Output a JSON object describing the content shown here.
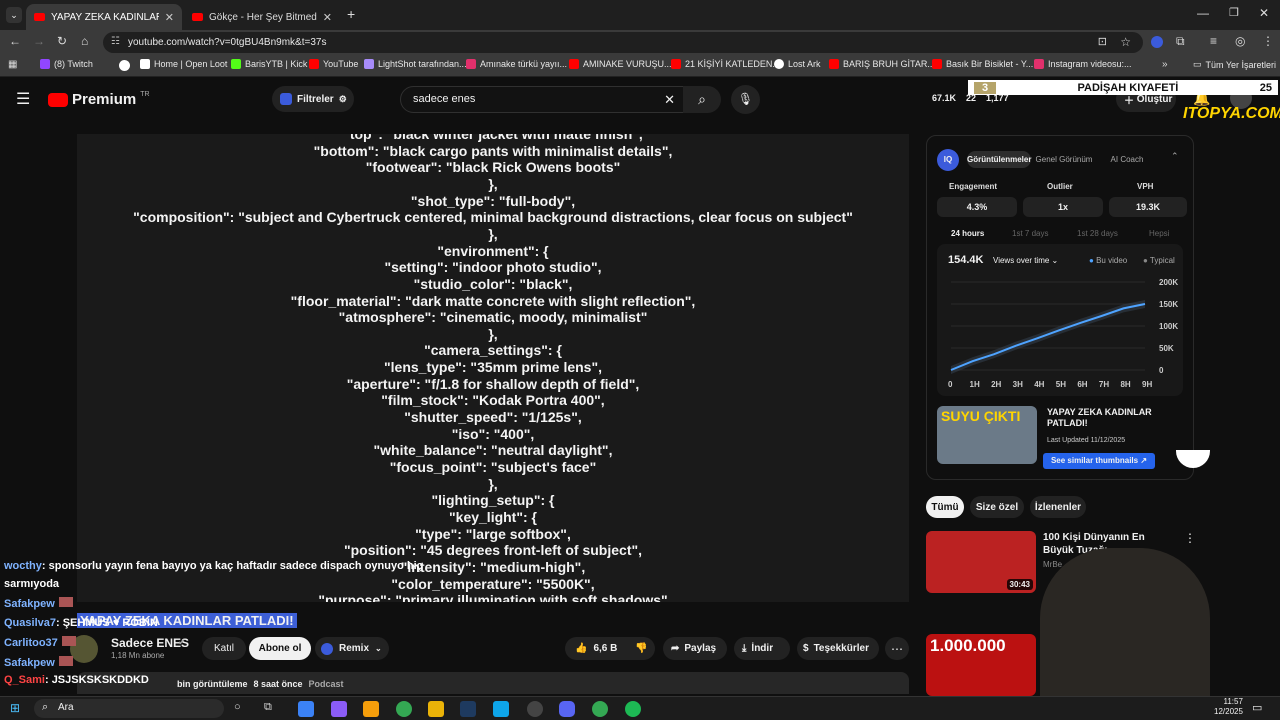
{
  "tabs": [
    {
      "label": "YAPAY ZEKA KADINLAR PATLADI!"
    },
    {
      "label": "Gökçe - Her Şey Bitmedi Bitem..."
    }
  ],
  "address": {
    "url": "youtube.com/watch?v=0tgBU4Bn9mk&t=37s"
  },
  "bookmarks": [
    {
      "label": "(8) Twitch",
      "color": "#9146ff"
    },
    {
      "label": "Home | Open Loot",
      "color": "#ffffff"
    },
    {
      "label": "BarisYTB | Kick",
      "color": "#53fc18"
    },
    {
      "label": "YouTube",
      "color": "#ff0000"
    },
    {
      "label": "LightShot tarafından...",
      "color": "#a78bfa"
    },
    {
      "label": "Amınake türkü yayıı...",
      "color": "#e1306c"
    },
    {
      "label": "AMINAKE VURUŞU...",
      "color": "#ff0000"
    },
    {
      "label": "21 KİŞİYİ KATLEDEN...",
      "color": "#ff0000"
    },
    {
      "label": "Lost Ark",
      "color": "#ffffff"
    },
    {
      "label": "BARIŞ BRUH GİTAR...",
      "color": "#ff0000"
    },
    {
      "label": "Basık Bir Bisiklet - Y...",
      "color": "#ff0000"
    },
    {
      "label": "Instagram videosu:...",
      "color": "#e1306c"
    }
  ],
  "bookmarks_all": "Tüm Yer İşaretleri",
  "header": {
    "brand": "Premium",
    "region": "TR",
    "filters": "Filtreler",
    "search_value": "sadece enes",
    "views": "67.1K",
    "likes": "22",
    "subs": "1,177",
    "create": "Oluştur"
  },
  "overlay": {
    "badge_num": "3",
    "name": "PADİŞAH KIYAFETİ",
    "count": "25",
    "site": "ITOPYA.COM"
  },
  "video": {
    "lines": [
      "\"top\": \"black winter jacket with matte finish\",",
      "\"bottom\": \"black cargo pants with minimalist details\",",
      "\"footwear\": \"black Rick Owens boots\"",
      "},",
      "\"shot_type\": \"full-body\",",
      "\"composition\": \"subject and Cybertruck centered, minimal background distractions, clear focus on subject\"",
      "},",
      "\"environment\": {",
      "\"setting\": \"indoor photo studio\",",
      "\"studio_color\": \"black\",",
      "\"floor_material\": \"dark matte concrete with slight reflection\",",
      "\"atmosphere\": \"cinematic, moody, minimalist\"",
      "},",
      "\"camera_settings\": {",
      "\"lens_type\": \"35mm prime lens\",",
      "\"aperture\": \"f/1.8 for shallow depth of field\",",
      "\"film_stock\": \"Kodak Portra 400\",",
      "\"shutter_speed\": \"1/125s\",",
      "\"iso\": \"400\",",
      "\"white_balance\": \"neutral daylight\",",
      "\"focus_point\": \"subject's face\"",
      "},",
      "\"lighting_setup\": {",
      "\"key_light\": {",
      "\"type\": \"large softbox\",",
      "\"position\": \"45 degrees front-left of subject\",",
      "\"intensity\": \"medium-high\",",
      "\"color_temperature\": \"5500K\",",
      "\"purpose\": \"primary illumination with soft shadows\""
    ]
  },
  "below": {
    "title": "YAPAY ZEKA KADINLAR PATLADI!",
    "channel": "Sadece ENES",
    "subs": "1,18 Mn abone",
    "join": "Katıl",
    "subscribe": "Abone ol",
    "remix": "Remix",
    "likes": "6,6 B",
    "share": "Paylaş",
    "download": "İndir",
    "thanks": "Teşekkürler",
    "meta_views": "bin görüntüleme",
    "meta_time": "8 saat önce",
    "meta_tag": "Podcast"
  },
  "vidiq": {
    "tabs": [
      "Görüntülenmeler",
      "Genel Görünüm",
      "AI Coach"
    ],
    "stat_labels": [
      "Engagement",
      "Outlier",
      "VPH"
    ],
    "stat_values": [
      "4.3%",
      "1x",
      "19.3K"
    ],
    "ranges": [
      "24 hours",
      "1st 7 days",
      "1st 28 days",
      "Hepsi"
    ],
    "total": "154.4K",
    "dropdown": "Views over time",
    "legend_this": "Bu video",
    "legend_typ": "Typical",
    "thumb_title": "YAPAY ZEKA KADINLAR PATLADI!",
    "thumb_text": "SUYU ÇIKTI",
    "updated": "Last Updated 11/12/2025",
    "similar": "See similar thumbnails"
  },
  "chart_data": {
    "type": "line",
    "x": [
      "0",
      "1H",
      "2H",
      "3H",
      "4H",
      "5H",
      "6H",
      "7H",
      "8H",
      "9H"
    ],
    "series": [
      {
        "name": "Bu video",
        "values": [
          0,
          20000,
          36000,
          55000,
          72000,
          90000,
          107000,
          123000,
          140000,
          150000
        ]
      }
    ],
    "yticks": [
      "200K",
      "150K",
      "100K",
      "50K",
      "0"
    ],
    "ylim": [
      0,
      200000
    ]
  },
  "chips": [
    "Tümü",
    "Size özel",
    "İzlenenler"
  ],
  "rec": [
    {
      "title": "100 Kişi Dünyanın En Büyük Tuzağı...",
      "channel": "MrBe...",
      "duration": "30:43"
    },
    {
      "thumb_text": "1.000.000"
    }
  ],
  "chat": [
    {
      "name": "wocthy",
      "text": ": sponsorlu yayın fena bayıyo ya kaç haftadır sadece dispach oynuyo hiç"
    },
    {
      "name": "",
      "text": "sarmıyoda"
    },
    {
      "name": "Safakpew",
      "text": ""
    },
    {
      "name": "Quasilva7",
      "text": ": ŞEHMUS ♥ ROBIN"
    },
    {
      "name": "Carlitoo37",
      "text": ""
    },
    {
      "name": "Safakpew",
      "text": ""
    },
    {
      "name": "Q_Sami",
      "text": ": JSJSKSKSKDDKD"
    }
  ],
  "taskbar": {
    "search": "Ara",
    "time": "11:57",
    "date": "12/2025"
  }
}
